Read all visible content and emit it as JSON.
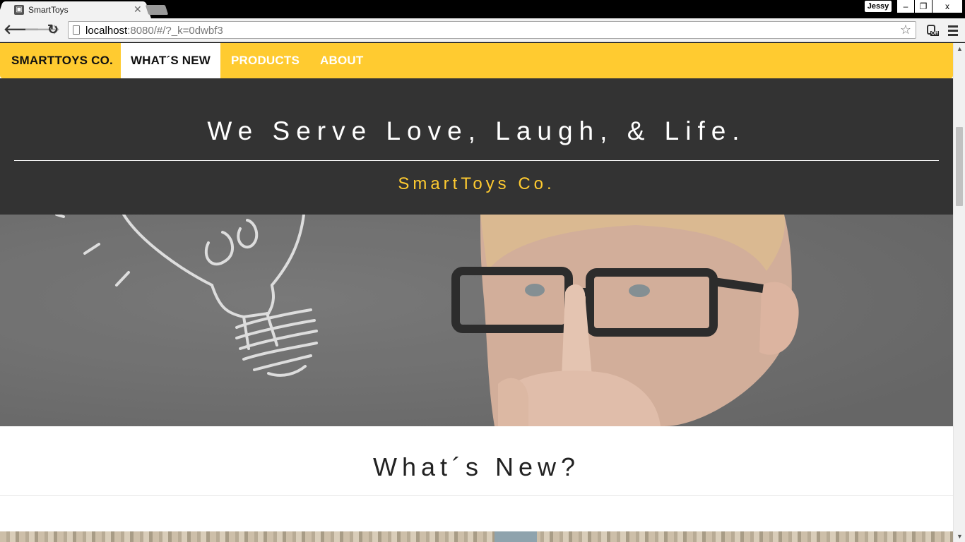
{
  "browser": {
    "tab_title": "SmartToys",
    "tab_favicon": "toy-icon",
    "profile_name": "Jessy",
    "url_host": "localhost",
    "url_rest": ":8080/#/?_k=0dwbf3",
    "window_buttons": {
      "minimize": "–",
      "maximize": "❐",
      "close": "x"
    },
    "extension_badge": "Off"
  },
  "site": {
    "brand": "SMARTTOYS CO.",
    "nav": [
      {
        "label": "WHAT´S NEW",
        "active": true
      },
      {
        "label": "PRODUCTS",
        "active": false
      },
      {
        "label": "ABOUT",
        "active": false
      }
    ],
    "hero": {
      "title": "We Serve Love, Laugh, & Life.",
      "subtitle": "SmartToys Co."
    },
    "section_title": "What´s New?"
  },
  "colors": {
    "accent_yellow": "#ffcb30",
    "header_dark": "#333333",
    "text_dark": "#222222"
  }
}
